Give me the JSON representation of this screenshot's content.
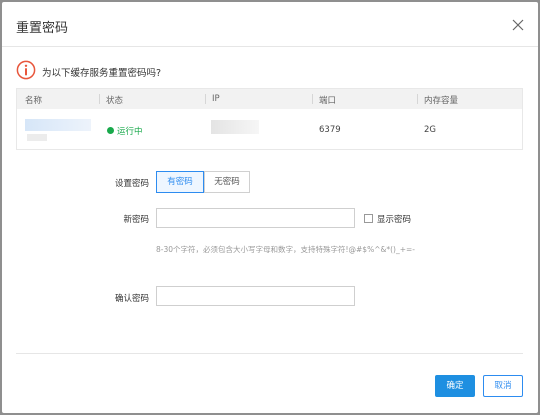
{
  "dialog": {
    "title": "重置密码",
    "question": "为以下缓存服务重置密码吗?"
  },
  "icons": {
    "close": "close-icon",
    "warning": "warning-circle-icon"
  },
  "colors": {
    "accent": "#2d8cf0",
    "primary_button": "#1e8fe1",
    "running": "#18a94b",
    "warning": "#e8563c"
  },
  "table": {
    "headers": [
      "名称",
      "状态",
      "IP",
      "端口",
      "内存容量"
    ],
    "rows": [
      {
        "name": "",
        "status": "运行中",
        "ip": "",
        "port": "6379",
        "memory": "2G"
      }
    ]
  },
  "form": {
    "password_setting_label": "设置密码",
    "option_with_password": "有密码",
    "option_without_password": "无密码",
    "new_password_label": "新密码",
    "new_password_value": "",
    "show_password_label": "显示密码",
    "hint": "8-30个字符，必须包含大小写字母和数字，支持特殊字符!@#$%^&*()_+=-",
    "confirm_password_label": "确认密码",
    "confirm_password_value": ""
  },
  "footer": {
    "ok_label": "确定",
    "cancel_label": "取消"
  }
}
